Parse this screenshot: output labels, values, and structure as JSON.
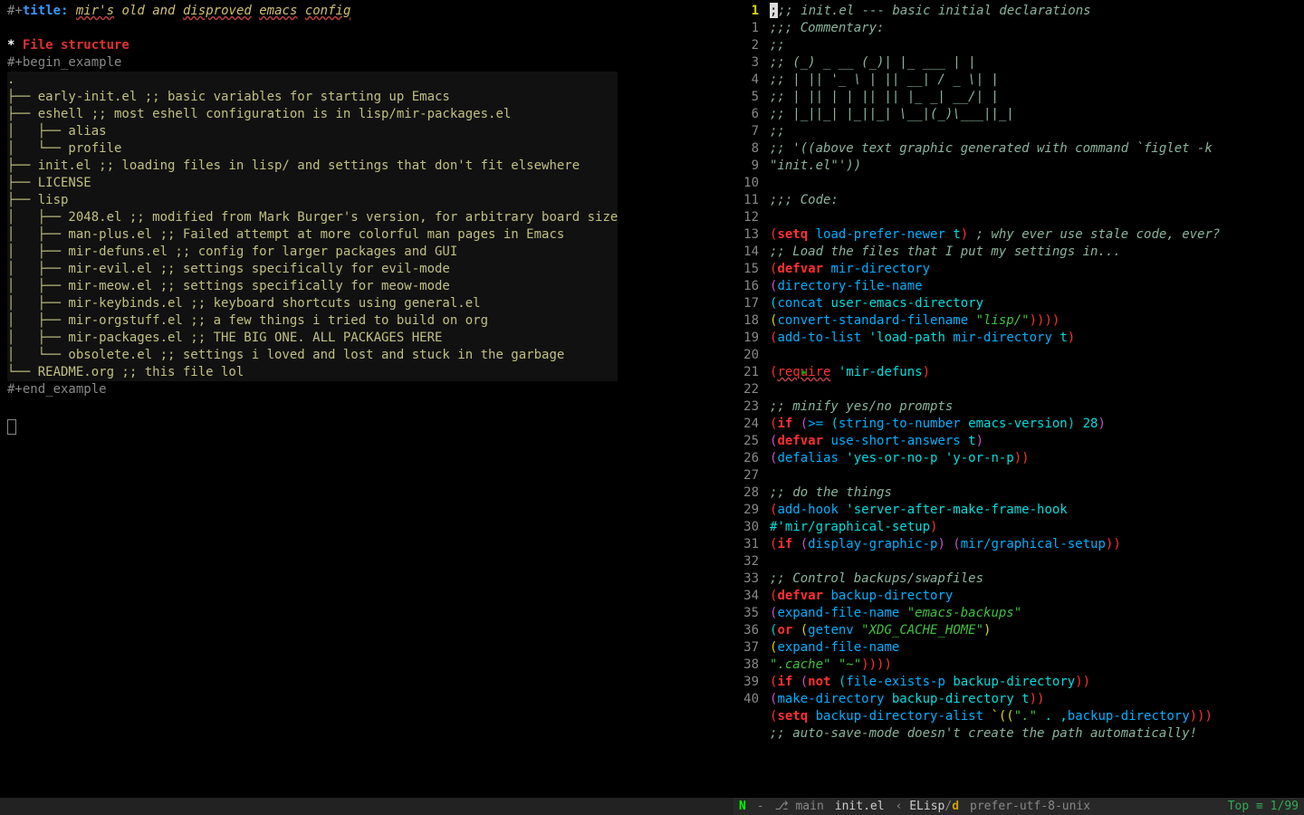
{
  "left": {
    "title_prefix": "#+",
    "title_key": "title:",
    "title_text_pre": " ",
    "title_words": [
      "mir's",
      "old",
      "and",
      "disproved",
      "emacs",
      "config"
    ],
    "heading": "File structure",
    "begin": "#+begin_example",
    "tree": [
      ".",
      "├── early-init.el ;; basic variables for starting up Emacs",
      "├── eshell ;; most eshell configuration is in lisp/mir-packages.el",
      "│   ├── alias",
      "│   └── profile",
      "├── init.el ;; loading files in lisp/ and settings that don't fit elsewhere",
      "├── LICENSE",
      "├── lisp",
      "│   ├── 2048.el ;; modified from Mark Burger's version, for arbitrary board size",
      "│   ├── man-plus.el ;; Failed attempt at more colorful man pages in Emacs",
      "│   ├── mir-defuns.el ;; config for larger packages and GUI",
      "│   ├── mir-evil.el ;; settings specifically for evil-mode",
      "│   ├── mir-meow.el ;; settings specifically for meow-mode",
      "│   ├── mir-keybinds.el ;; keyboard shortcuts using general.el",
      "│   ├── mir-orgstuff.el ;; a few things i tried to build on org",
      "│   ├── mir-packages.el ;; THE BIG ONE. ALL PACKAGES HERE",
      "│   └── obsolete.el ;; settings i loved and lost and stuck in the garbage",
      "└── README.org ;; this file lol"
    ],
    "end": "#+end_example"
  },
  "right": {
    "gutter_current": "1",
    "gutter": [
      "1",
      "2",
      "3",
      "4",
      "5",
      "6",
      "7",
      "8",
      "9",
      "10",
      "11",
      "12",
      "13",
      "14",
      "15",
      "16",
      "17",
      "18",
      "19",
      "20",
      "21",
      "22",
      "23",
      "24",
      "25",
      "26",
      "27",
      "28",
      "29",
      "30",
      "31",
      "32",
      "33",
      "34",
      "35",
      "36",
      "37",
      "38",
      "39",
      "40"
    ],
    "lines": {
      "l0": ";;; init.el --- basic initial declarations",
      "l1": ";;; Commentary:",
      "l2": ";;",
      "l3": ";;  (_) _ __  (_)| |_     ___ | |",
      "l4": ";;  | || '_ \\ | || __|   / _ \\| |",
      "l5": ";;  | || | | || || |_  _|  __/| |",
      "l6": ";;  |_||_| |_||_| \\__|(_)\\___||_|",
      "l7": ";;",
      "l8a": ";; '((above text graphic generated with command `figlet -k ",
      "l8b": "\"init.el\"'))",
      "l9": "",
      "l10": ";;; Code:",
      "l11": "",
      "l12_a": "(",
      "l12_b": "setq",
      "l12_c": " load-prefer-newer ",
      "l12_d": "t",
      "l12_e": ")",
      "l12_f": " ; why ever use stale code, ever?",
      "l13": ";; Load the files that I put my settings in...",
      "l14_a": "(",
      "l14_b": "defvar",
      "l14_c": " mir-directory",
      "l15_a": "  (",
      "l15_b": "directory-file-name",
      "l16_a": "   (",
      "l16_b": "concat",
      "l16_c": " user-emacs-directory",
      "l17_a": "           (",
      "l17_b": "convert-standard-filename",
      "l17_c": " ",
      "l17_d": "\"lisp/\"",
      "l17_e": "))))",
      "l18_a": "(",
      "l18_b": "add-to-list",
      "l18_c": " 'load-path ",
      "l18_d": "mir-directory",
      "l18_e": " t",
      ")": "",
      "l18_f": ")",
      "l19": "",
      "l20_a": "(",
      "l20_b": "require",
      "l20_c": " 'mir-defuns",
      "l20_d": ")",
      "l21": "",
      "l22": ";; minify yes/no prompts",
      "l23_a": "(",
      "l23_b": "if",
      "l23_c": " (",
      "l23_d": ">=",
      "l23_e": " (",
      "l23_f": "string-to-number",
      "l23_g": " emacs-version",
      "l23_h": ") ",
      "l23_i": "28",
      "l23_j": ")",
      "l24_a": "    (",
      "l24_b": "defvar",
      "l24_c": " use-short-answers ",
      "l24_d": "t",
      "l24_e": ")",
      "l25_a": "  (",
      "l25_b": "defalias",
      "l25_c": " 'yes-or-no-p 'y-or-n-p",
      "l25_d": "))",
      "l26": "",
      "l27": ";; do the things",
      "l28_a": "(",
      "l28_b": "add-hook",
      "l28_c": " 'server-after-make-frame-hook",
      "l28x": "  #'mir/graphical-setup",
      "l28_d": ")",
      "l29_a": "(",
      "l29_b": "if",
      "l29_c": " (",
      "l29_d": "display-graphic-p",
      "l29_e": ") (",
      "l29_f": "mir/graphical-setup",
      "l29_g": "))",
      "l30": "",
      "l31": ";; Control backups/swapfiles",
      "l32_a": "(",
      "l32_b": "defvar",
      "l32_c": " backup-directory",
      "l33_a": "  (",
      "l33_b": "expand-file-name",
      "l33_c": " ",
      "l33_d": "\"emacs-backups\"",
      "l34_a": "                    (",
      "l34_b": "or",
      "l34_c": " (",
      "l34_d": "getenv",
      "l34_e": " ",
      "l34_f": "\"XDG_CACHE_HOME\"",
      "l34_g": ")",
      "l35_a": "                        (",
      "l35_b": "expand-file-name",
      "l36_a": "                         ",
      "l36_b": "\".cache\"",
      "l36_c": " ",
      "l36_d": "\"~\"",
      "l36_e": "))))",
      "l37_a": "(",
      "l37_b": "if",
      "l37_c": " (",
      "l37_d": "not",
      "l37_e": " (",
      "l37_f": "file-exists-p",
      "l37_g": " backup-directory",
      "l37_h": "))",
      "l38_a": "    (",
      "l38_b": "make-directory",
      "l38_c": " backup-directory ",
      "l38_d": "t",
      "l38_e": "))",
      "l39_a": "(",
      "l39_b": "setq",
      "l39_c": " backup-directory-alist ",
      "l39_d": "`((",
      "l39_e": "\".\"",
      "l39_f": " . ,",
      "l39_g": "backup-directory",
      "l39_h": ")))",
      "l40": ";; auto-save-mode doesn't create the path automatically!"
    }
  },
  "modeline": {
    "evil": "N",
    "dash": "-",
    "branch_icon": "⎇",
    "branch": "main",
    "buffer": "init.el",
    "l_angle": "‹",
    "mode": "ELisp",
    "slash": "/",
    "d": "d",
    "enc": "prefer-utf-8-unix",
    "pos": "Top ≡ 1/99"
  }
}
